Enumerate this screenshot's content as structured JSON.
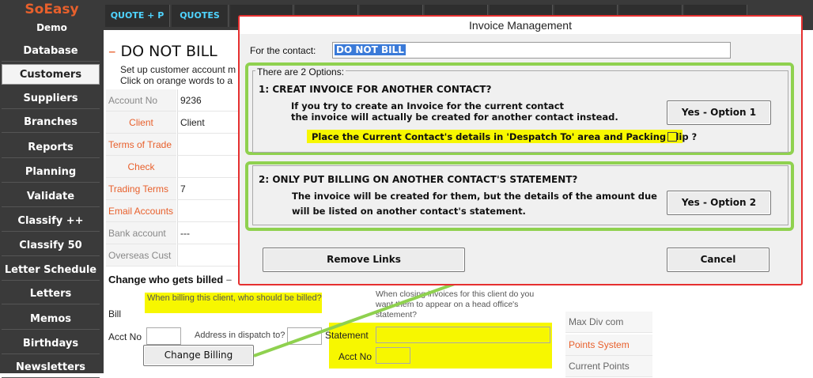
{
  "brand": {
    "name": "SoEasy",
    "sub": "Demo"
  },
  "sidebar": {
    "items": [
      {
        "label": "Database"
      },
      {
        "label": "Customers"
      },
      {
        "label": "Suppliers"
      },
      {
        "label": "Branches"
      },
      {
        "label": "Reports"
      },
      {
        "label": "Planning"
      },
      {
        "label": "Validate"
      },
      {
        "label": "Classify ++"
      },
      {
        "label": "Classify 50"
      },
      {
        "label": "Letter Schedule"
      },
      {
        "label": "Letters"
      },
      {
        "label": "Memos"
      },
      {
        "label": "Birthdays"
      },
      {
        "label": "Newsletters"
      }
    ]
  },
  "tabs": [
    {
      "label": "QUOTE + P"
    },
    {
      "label": "QUOTES"
    }
  ],
  "page": {
    "title": "DO NOT BILL",
    "intro_line1": "Set up customer account m",
    "intro_line2": "Click on orange words to a"
  },
  "fields": [
    {
      "label": "Account No",
      "value": "9236"
    },
    {
      "label": "Client",
      "value": "Client"
    },
    {
      "label": "Terms of Trade",
      "value": ""
    },
    {
      "label": "Check",
      "value": ""
    },
    {
      "label": "Trading Terms",
      "value": "7"
    },
    {
      "label": "Email Accounts",
      "value": ""
    },
    {
      "label": "Bank account",
      "value": "---"
    },
    {
      "label": "Overseas Cust",
      "value": ""
    }
  ],
  "billing": {
    "title": "Change who gets billed",
    "question": "When billing this client, who should be billed?",
    "bill_label": "Bill",
    "acct_no_label": "Acct No",
    "address_label": "Address in dispatch to?",
    "closing_note": "When closing invoices for this client do you want them to appear on a head office's statement?",
    "statement_label": "Statement",
    "acct_no_label2": "Acct No",
    "change_button": "Change Billing"
  },
  "right_fields": [
    {
      "label": "Max Div com"
    },
    {
      "label": "Points System"
    },
    {
      "label": "Current Points"
    }
  ],
  "dialog": {
    "title": "Invoice Management",
    "contact_label": "For the contact:",
    "contact_value": "DO NOT BILL",
    "options_header": "There are 2 Options:",
    "opt1_title": "1: CREAT INVOICE FOR ANOTHER CONTACT?",
    "opt1_desc1": "If you try to create an Invoice for the current contact",
    "opt1_desc2": "the invoice will actually be created for another contact instead.",
    "opt1_button": "Yes - Option 1",
    "opt1_check": "Place the Current Contact's details in 'Despatch To' area and Packing Slip ?",
    "opt2_title": "2: ONLY PUT BILLING ON ANOTHER CONTACT'S STATEMENT?",
    "opt2_desc1": "The invoice will be created for them, but the details of the amount due",
    "opt2_desc2": "will be listed on another contact's statement.",
    "opt2_button": "Yes - Option 2",
    "remove_button": "Remove Links",
    "cancel_button": "Cancel"
  },
  "colors": {
    "accent": "#e8602c",
    "highlight": "#f7f700",
    "annotation_green": "#8fd14f",
    "dialog_border": "#e63030"
  }
}
